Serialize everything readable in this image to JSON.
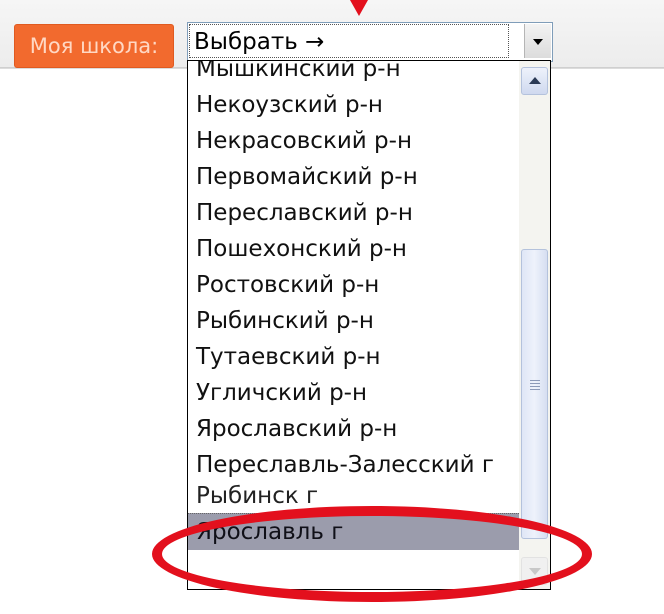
{
  "school_selector": {
    "label": "Моя школа:",
    "selected_value": "Выбрать →",
    "options": [
      "Мышкинский р-н",
      "Некоузский р-н",
      "Некрасовский р-н",
      "Первомайский р-н",
      "Переславский р-н",
      "Пошехонский р-н",
      "Ростовский р-н",
      "Рыбинский р-н",
      "Тутаевский р-н",
      "Угличский р-н",
      "Ярославский р-н",
      "Переславль-Залесский г",
      "Рыбинск г"
    ],
    "highlighted_option": "Ярославль г"
  },
  "colors": {
    "label_bg": "#f26a2e",
    "annotation": "#e3101d",
    "highlight_bg": "#9b9cac"
  }
}
